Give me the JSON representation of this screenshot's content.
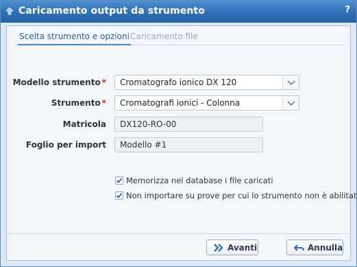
{
  "dialog": {
    "title": "Caricamento output da strumento",
    "help": "?"
  },
  "tabs": [
    {
      "label": "Scelta strumento e opzioni",
      "active": true
    },
    {
      "label": "Caricamento file",
      "active": false
    }
  ],
  "form": {
    "model": {
      "label": "Modello strumento",
      "required": "*",
      "value": "Cromatografo ionico DX 120"
    },
    "instrument": {
      "label": "Strumento",
      "required": "*",
      "value": "Cromatografi ionici - Colonna"
    },
    "serial": {
      "label": "Matricola",
      "value": "DX120-RO-00"
    },
    "import_sheet": {
      "label": "Foglio per import",
      "value": "Modello #1"
    }
  },
  "options": [
    {
      "label": "Memorizza nel database i file caricati",
      "checked": true
    },
    {
      "label": "Non importare su prove per cui lo strumento non è abilitato",
      "checked": true
    }
  ],
  "buttons": {
    "next": "Avanti",
    "cancel": "Annulla"
  },
  "colors": {
    "titlebar": "#2e6fb5",
    "accent": "#4a86c5",
    "required": "#dd2222"
  }
}
